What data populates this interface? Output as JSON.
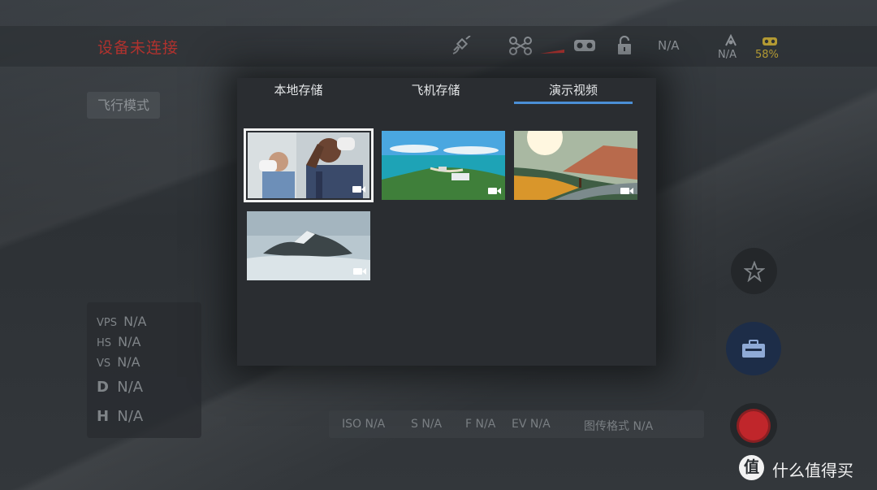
{
  "status": {
    "title": "设备未连接",
    "signal_na": "N/A",
    "gimbal_na": "N/A",
    "battery_pct": "58%"
  },
  "flight_mode": {
    "label": "飞行模式"
  },
  "telemetry": {
    "vps_label": "VPS",
    "vps_value": "N/A",
    "hs_label": "HS",
    "hs_value": "N/A",
    "vs_label": "VS",
    "vs_value": "N/A",
    "d_label": "D",
    "d_value": "N/A",
    "h_label": "H",
    "h_value": "N/A"
  },
  "camera_params": {
    "iso": "ISO N/A",
    "shutter": "S N/A",
    "aperture": "F N/A",
    "ev": "EV N/A",
    "format": "图传格式 N/A"
  },
  "modal": {
    "tabs": [
      {
        "label": "本地存储",
        "active": false
      },
      {
        "label": "飞机存储",
        "active": false
      },
      {
        "label": "演示视频",
        "active": true
      }
    ],
    "videos": [
      {
        "name": "goggles-users",
        "selected": true
      },
      {
        "name": "coastline",
        "selected": false
      },
      {
        "name": "sunset-road",
        "selected": false
      },
      {
        "name": "snowy-mountain",
        "selected": false
      }
    ]
  },
  "icons": {
    "satellite": "satellite-icon",
    "drone": "drone-icon",
    "goggles": "goggles-icon",
    "lock": "unlock-icon",
    "gimbal": "gimbal-icon",
    "video-tag": "video-camera-icon"
  },
  "colors": {
    "alert_red": "#b0322e",
    "tab_accent": "#4b8fd6",
    "battery_yellow": "#b39a33",
    "record_red": "#c0262b"
  },
  "watermark": {
    "badge": "值",
    "text": "什么值得买"
  }
}
